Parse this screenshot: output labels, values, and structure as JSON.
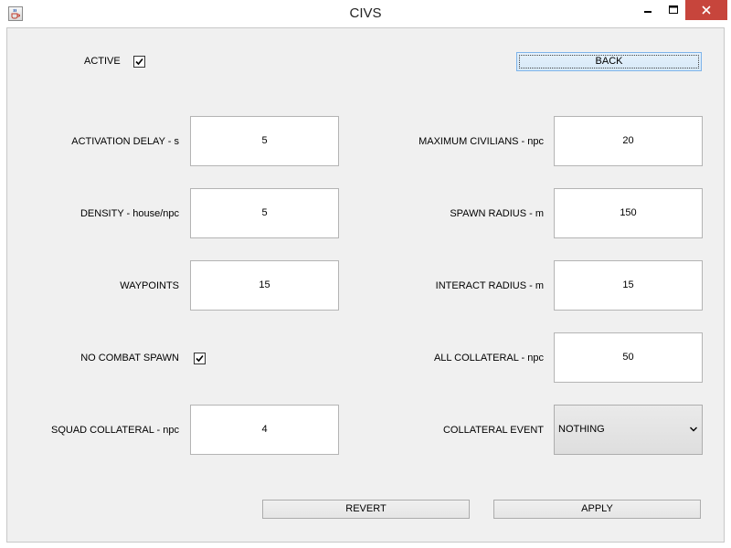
{
  "window": {
    "title": "CIVS",
    "icons": {
      "app": "java-cup-icon",
      "minimize": "minimize-icon",
      "maximize": "maximize-icon",
      "close": "close-icon"
    },
    "colors": {
      "close_bg": "#c7453c",
      "client_bg": "#f0f0f0",
      "focus_border": "#7eb4ea"
    }
  },
  "controls": {
    "active": {
      "label": "ACTIVE",
      "checked": true
    },
    "back_button": "BACK",
    "no_combat_spawn": {
      "label": "NO COMBAT SPAWN",
      "checked": true
    }
  },
  "fields": {
    "activation_delay": {
      "label": "ACTIVATION DELAY   - s",
      "value": "5"
    },
    "density": {
      "label": "DENSITY   - house/npc",
      "value": "5"
    },
    "waypoints": {
      "label": "WAYPOINTS",
      "value": "15"
    },
    "squad_collateral": {
      "label": "SQUAD COLLATERAL   - npc",
      "value": "4"
    },
    "maximum_civilians": {
      "label": "MAXIMUM CIVILIANS   - npc",
      "value": "20"
    },
    "spawn_radius": {
      "label": "SPAWN RADIUS   - m",
      "value": "150"
    },
    "interact_radius": {
      "label": "INTERACT RADIUS   - m",
      "value": "15"
    },
    "all_collateral": {
      "label": "ALL COLLATERAL   - npc",
      "value": "50"
    },
    "collateral_event": {
      "label": "COLLATERAL EVENT",
      "value": "NOTHING"
    }
  },
  "footer": {
    "revert": "REVERT",
    "apply": "APPLY"
  }
}
